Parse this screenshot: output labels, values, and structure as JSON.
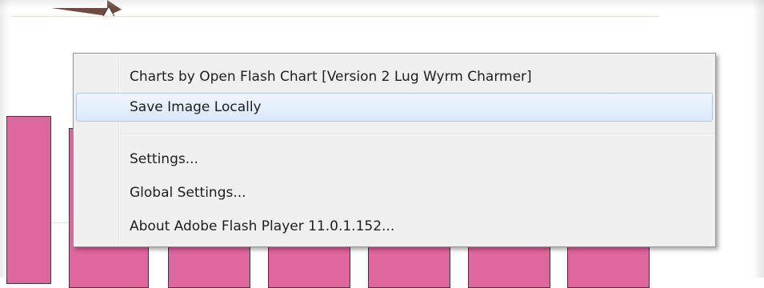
{
  "context_menu": {
    "items": [
      {
        "label": "Charts by Open Flash Chart [Version 2 Lug Wyrm Charmer]",
        "highlighted": false
      },
      {
        "label": "Save Image Locally",
        "highlighted": true
      },
      {
        "label": "Settings...",
        "highlighted": false
      },
      {
        "label": "Global Settings...",
        "highlighted": false
      },
      {
        "label": "About Adobe Flash Player 11.0.1.152...",
        "highlighted": false
      }
    ]
  },
  "chart": {
    "bar_color": "#e0669e",
    "gridline_color": "#f3dfc6"
  }
}
